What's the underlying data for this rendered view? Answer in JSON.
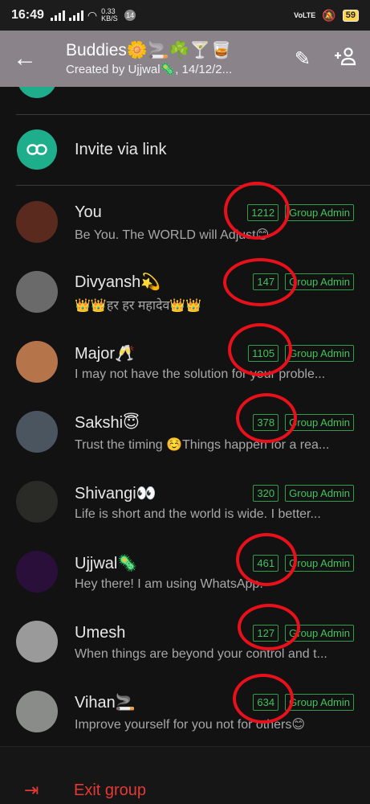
{
  "status_bar": {
    "time": "16:49",
    "net_speed": "0.33 KB/S",
    "notif_count": "14",
    "network_label": "VoLTE",
    "battery": "59"
  },
  "header": {
    "title": "Buddies🌼🚬☘️🍸🥃",
    "subtitle": "Created by Ujjwal🦠, 14/12/2...",
    "back_icon": "arrow-back-icon",
    "edit_icon": "pencil-icon",
    "add_icon": "add-person-icon"
  },
  "invite": {
    "label": "Invite via link",
    "icon": "link-icon"
  },
  "members": [
    {
      "name": "You",
      "about": "Be You. The WORLD will Adjust😊",
      "count": "1212",
      "admin": "Group Admin",
      "avatar_color": "#5a2a1e"
    },
    {
      "name": "Divyansh💫",
      "about": "👑👑हर हर महादेव👑👑",
      "count": "147",
      "admin": "Group Admin",
      "avatar_color": "#6b6a6a"
    },
    {
      "name": "Major🥂",
      "about": "I may not have the solution for your proble...",
      "count": "1105",
      "admin": "Group Admin",
      "avatar_color": "#b5744a"
    },
    {
      "name": "Sakshi😇",
      "about": "Trust the timing ☺️Things happen for a rea...",
      "count": "378",
      "admin": "Group Admin",
      "avatar_color": "#4a5560"
    },
    {
      "name": "Shivangi👀",
      "about": "Life is short and the world is wide. I better...",
      "count": "320",
      "admin": "Group Admin",
      "avatar_color": "#2a2a26"
    },
    {
      "name": "Ujjwal🦠",
      "about": "Hey there! I am using WhatsApp.",
      "count": "461",
      "admin": "Group Admin",
      "avatar_color": "#2a0f3a"
    },
    {
      "name": "Umesh",
      "about": "When things are beyond your control and t...",
      "count": "127",
      "admin": "Group Admin",
      "avatar_color": "#9a9a9a"
    },
    {
      "name": "Vihan🚬",
      "about": "Improve yourself for you not for others😊",
      "count": "634",
      "admin": "Group Admin",
      "avatar_color": "#8a8c8a"
    }
  ],
  "exit": {
    "label": "Exit group",
    "icon": "exit-icon",
    "color": "#e53935"
  },
  "colors": {
    "accent": "#1fae8b",
    "tag_green": "#43c25d",
    "annotation_red": "#e8101a"
  }
}
